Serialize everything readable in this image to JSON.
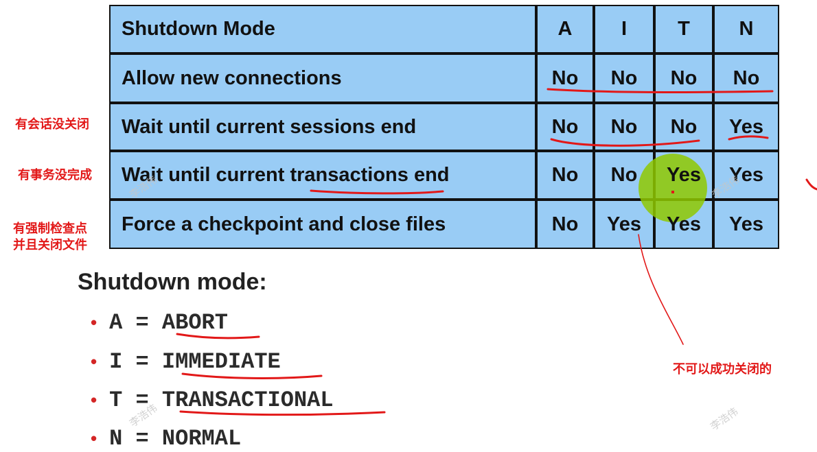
{
  "table": {
    "header": {
      "mode_label": "Shutdown Mode",
      "columns": [
        "A",
        "I",
        "T",
        "N"
      ]
    },
    "rows": [
      {
        "label": "Allow new connections",
        "values": [
          "No",
          "No",
          "No",
          "No"
        ]
      },
      {
        "label": "Wait until current sessions end",
        "values": [
          "No",
          "No",
          "No",
          "Yes"
        ]
      },
      {
        "label_prefix": "Wait until current ",
        "label_emph": "transactions",
        "label_suffix": " end",
        "values": [
          "No",
          "No",
          "Yes",
          "Yes"
        ]
      },
      {
        "label": "Force a checkpoint and close files",
        "values": [
          "No",
          "Yes",
          "Yes",
          "Yes"
        ]
      }
    ]
  },
  "notes": {
    "sessions": "有会话没关闭",
    "transactions": "有事务没完成",
    "checkpoint_line1": "有强制检查点",
    "checkpoint_line2": "并且关闭文件",
    "cannot_close": "不可以成功关闭的"
  },
  "legend": {
    "title": "Shutdown mode:",
    "items": [
      {
        "key": "A",
        "eq": " = ",
        "value": "ABORT"
      },
      {
        "key": "I",
        "eq": " = ",
        "value": "IMMEDIATE"
      },
      {
        "key": "T",
        "eq": " = ",
        "value": "TRANSACTIONAL"
      },
      {
        "key": "N",
        "eq": " = ",
        "value": "NORMAL"
      }
    ]
  },
  "watermark": "李浩伟",
  "colors": {
    "table_fill": "#99ccf5",
    "annotation_red": "#e21818",
    "highlight_green": "#8fc800"
  }
}
